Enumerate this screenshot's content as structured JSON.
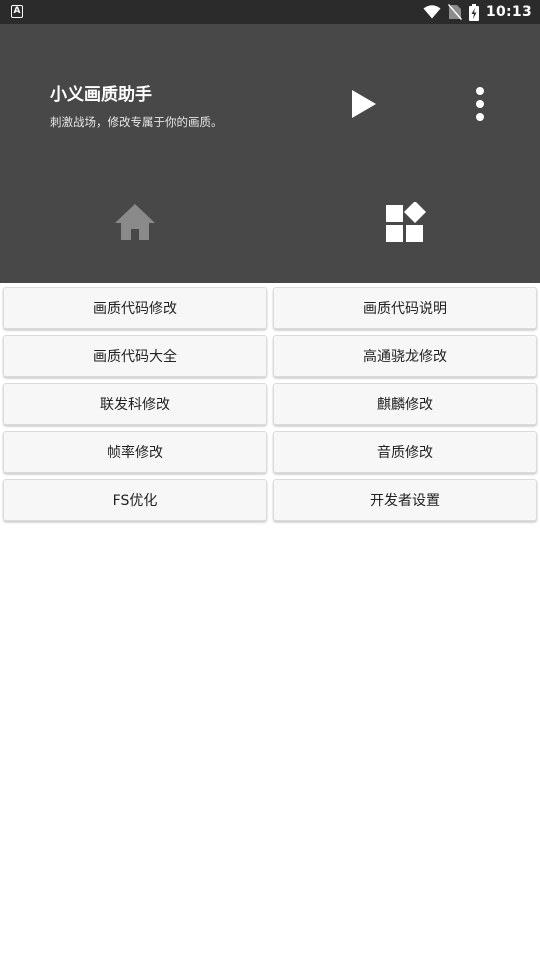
{
  "status_bar": {
    "left_icon": "notification-a-icon",
    "icons": [
      "wifi-icon",
      "no-sim-icon",
      "battery-charging-icon"
    ],
    "time": "10:13"
  },
  "header": {
    "title": "小义画质助手",
    "subtitle": "刺激战场，修改专属于你的画质。",
    "play_icon": "play-icon",
    "more_icon": "more-vert-icon"
  },
  "nav": [
    {
      "icon": "home-icon",
      "selected": false
    },
    {
      "icon": "widgets-icon",
      "selected": true
    }
  ],
  "colors": {
    "status_bar": "#2b2b2b",
    "header": "#484848",
    "nav_inactive": "#8a8a8a",
    "nav_active": "#ffffff",
    "button_bg": "#f7f7f7"
  },
  "buttons": [
    {
      "label": "画质代码修改"
    },
    {
      "label": "画质代码说明"
    },
    {
      "label": "画质代码大全"
    },
    {
      "label": "高通骁龙修改"
    },
    {
      "label": "联发科修改"
    },
    {
      "label": "麒麟修改"
    },
    {
      "label": "帧率修改"
    },
    {
      "label": "音质修改"
    },
    {
      "label": "FS优化"
    },
    {
      "label": "开发者设置"
    }
  ]
}
